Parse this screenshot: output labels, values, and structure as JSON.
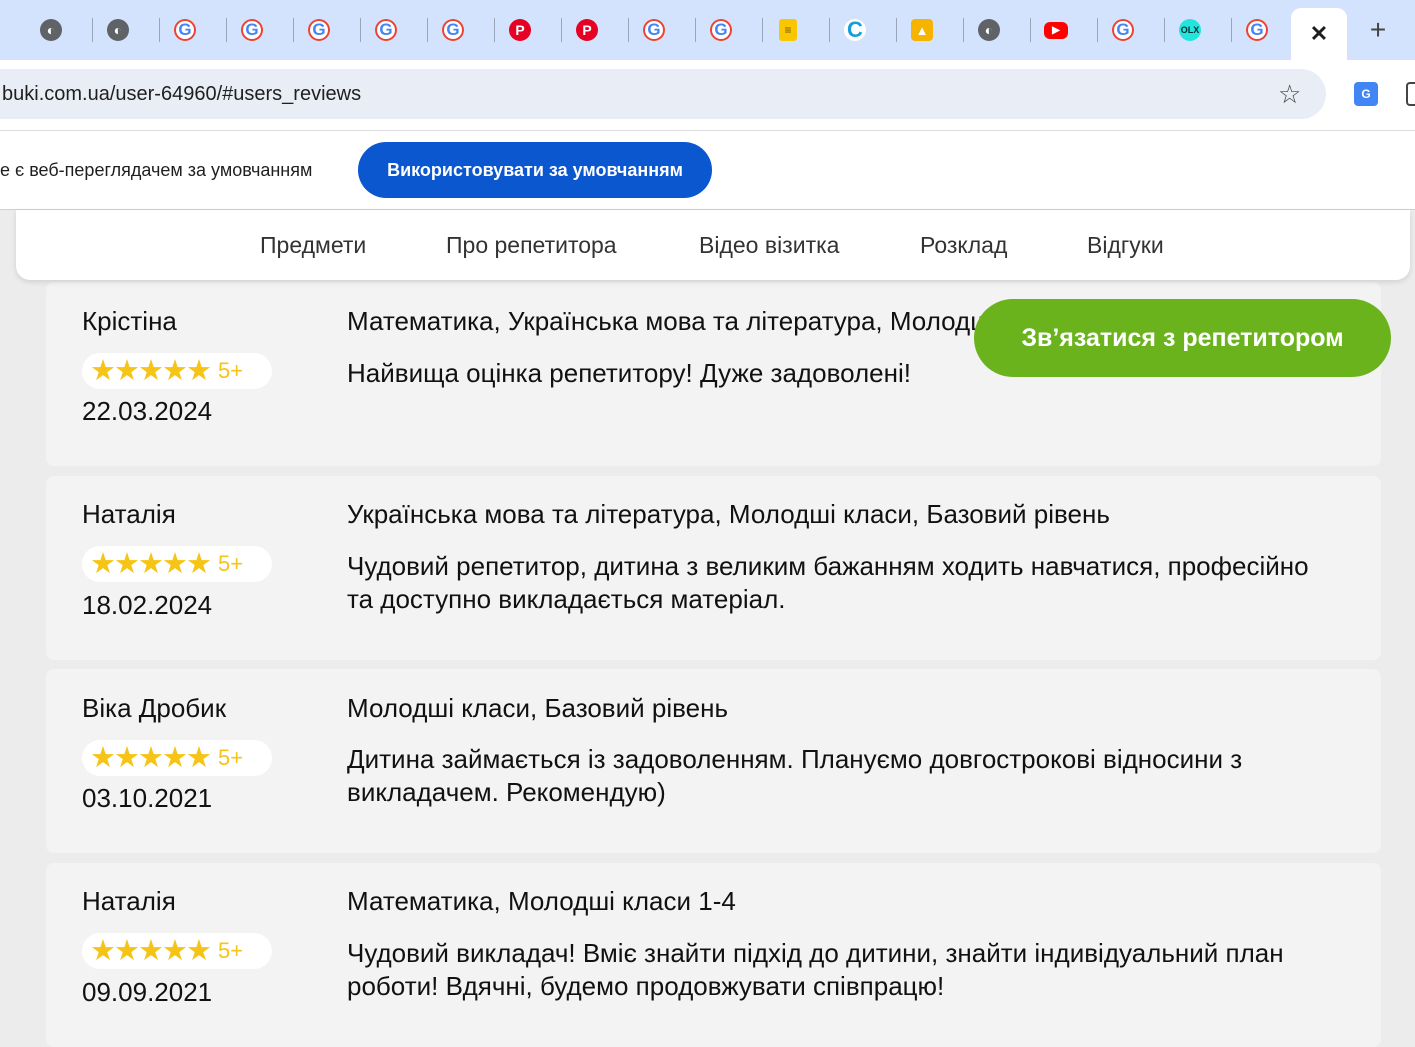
{
  "browser": {
    "tabs": [
      {
        "icon": "globe-icon",
        "glyph": "◐"
      },
      {
        "icon": "globe-icon",
        "glyph": "◐"
      },
      {
        "icon": "google-icon",
        "glyph": "G"
      },
      {
        "icon": "google-icon",
        "glyph": "G"
      },
      {
        "icon": "google-icon",
        "glyph": "G"
      },
      {
        "icon": "google-icon",
        "glyph": "G"
      },
      {
        "icon": "google-icon",
        "glyph": "G"
      },
      {
        "icon": "pinterest-icon",
        "glyph": "P"
      },
      {
        "icon": "pinterest-icon",
        "glyph": "P"
      },
      {
        "icon": "google-icon",
        "glyph": "G"
      },
      {
        "icon": "google-icon",
        "glyph": "G"
      },
      {
        "icon": "document-icon",
        "glyph": "≡"
      },
      {
        "icon": "c-letter-icon",
        "glyph": "C"
      },
      {
        "icon": "bell-icon",
        "glyph": "▲"
      },
      {
        "icon": "globe-icon",
        "glyph": "◐"
      },
      {
        "icon": "youtube-icon",
        "glyph": "▶"
      },
      {
        "icon": "google-icon",
        "glyph": "G"
      },
      {
        "icon": "olx-icon",
        "glyph": "OLX"
      },
      {
        "icon": "google-icon",
        "glyph": "G"
      }
    ],
    "active_tab_close_icon": "close-icon",
    "close_glyph": "✕",
    "new_tab_glyph": "+",
    "url": "buki.com.ua/user-64960/#users_reviews",
    "bookmark_glyph": "☆",
    "translate_glyph": "G"
  },
  "infobar": {
    "message": "е є веб-переглядачем за умовчанням",
    "button_label": "Використовувати за умовчанням"
  },
  "nav": {
    "items": [
      "Предмети",
      "Про репетитора",
      "Відео візитка",
      "Розклад",
      "Відгуки"
    ]
  },
  "contact_button": "Зв’язатися з репетитором",
  "reviews": [
    {
      "name": "Крістіна",
      "stars": "★★★★★",
      "score": "5+",
      "date": "22.03.2024",
      "subjects": "Математика, Українська мова та література, Молодші класи",
      "text": "Найвища оцінка репетитору! Дуже задоволені!"
    },
    {
      "name": "Наталія",
      "stars": "★★★★★",
      "score": "5+",
      "date": "18.02.2024",
      "subjects": "Українська мова та література, Молодші класи, Базовий рівень",
      "text": "Чудовий репетитор, дитина з великим бажанням ходить навчатися, професійно та доступно викладається матеріал."
    },
    {
      "name": "Віка Дробик",
      "stars": "★★★★★",
      "score": "5+",
      "date": "03.10.2021",
      "subjects": "Молодші класи, Базовий рівень",
      "text": "Дитина займається із задоволенням. Плануємо довгострокові відносини з викладачем. Рекомендую)"
    },
    {
      "name": "Наталія",
      "stars": "★★★★★",
      "score": "5+",
      "date": "09.09.2021",
      "subjects": "Математика, Молодші класи 1-4",
      "text": "Чудовий викладач! Вміє знайти підхід до дитини, знайти індивідуальний план роботи! Вдячні, будемо продовжувати співпрацю!"
    }
  ]
}
